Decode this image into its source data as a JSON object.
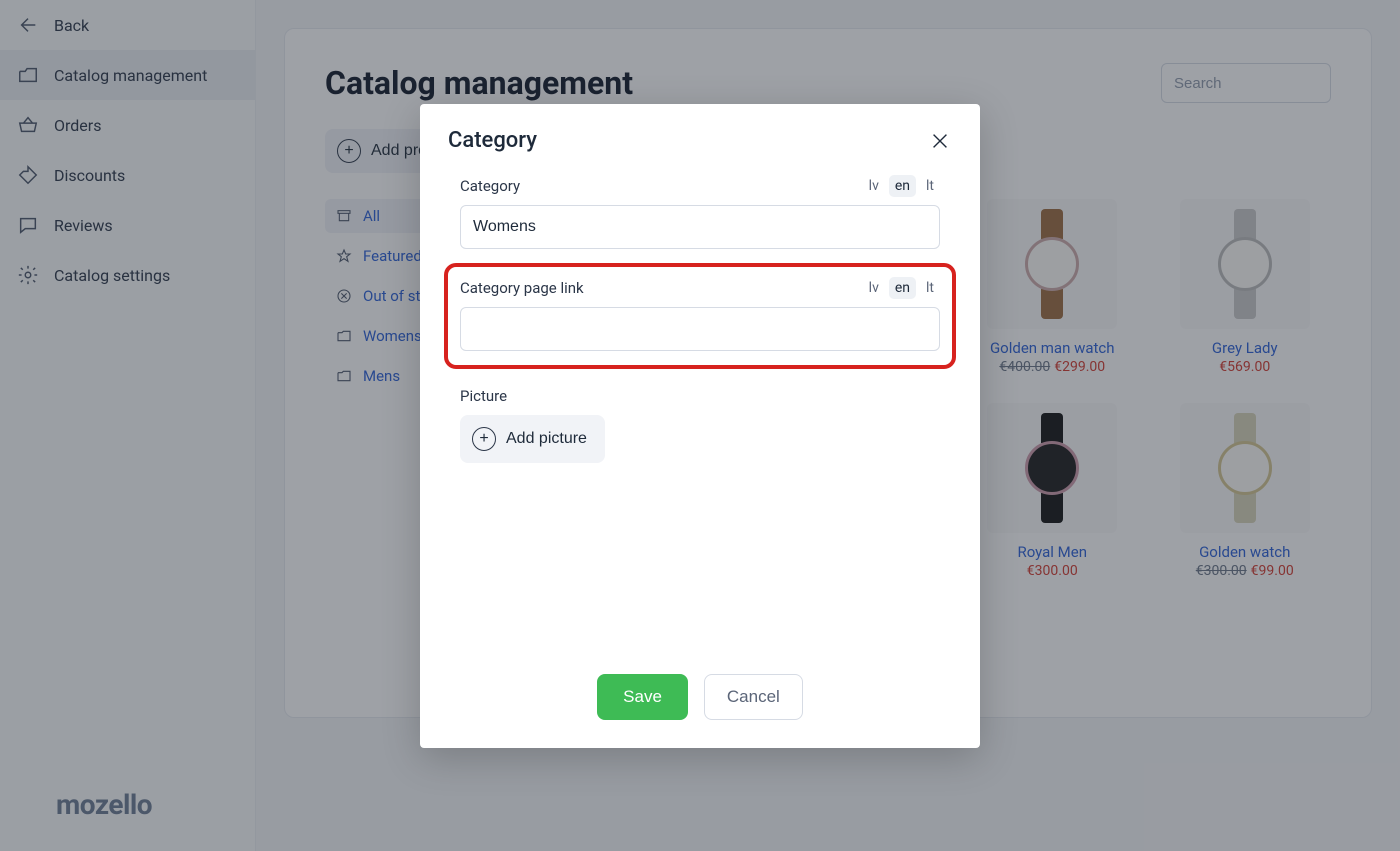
{
  "sidebar": {
    "back": "Back",
    "items": [
      {
        "label": "Catalog management"
      },
      {
        "label": "Orders"
      },
      {
        "label": "Discounts"
      },
      {
        "label": "Reviews"
      },
      {
        "label": "Catalog settings"
      }
    ]
  },
  "logo": "mozello",
  "page": {
    "title": "Catalog management",
    "search_placeholder": "Search",
    "add_product_label": "Add product"
  },
  "categories": {
    "all": "All",
    "featured": "Featured",
    "out_of_stock": "Out of stock",
    "womens": "Womens",
    "mens": "Mens"
  },
  "products": [
    {
      "name": "Golden man watch",
      "old_price": "€400.00",
      "new_price": "€299.00",
      "style": "w1"
    },
    {
      "name": "Grey Lady",
      "old_price": "",
      "new_price": "€569.00",
      "style": "w2"
    },
    {
      "name": "Royal Men",
      "old_price": "",
      "new_price": "€300.00",
      "style": "w3"
    },
    {
      "name": "Golden watch",
      "old_price": "€300.00",
      "new_price": "€99.00",
      "style": "w4"
    }
  ],
  "modal": {
    "title": "Category",
    "field_category_label": "Category",
    "field_category_value": "Womens",
    "field_link_label": "Category page link",
    "field_link_value": "",
    "picture_label": "Picture",
    "add_picture_label": "Add picture",
    "langs": {
      "lv": "lv",
      "en": "en",
      "lt": "lt",
      "active": "en"
    },
    "save": "Save",
    "cancel": "Cancel"
  }
}
